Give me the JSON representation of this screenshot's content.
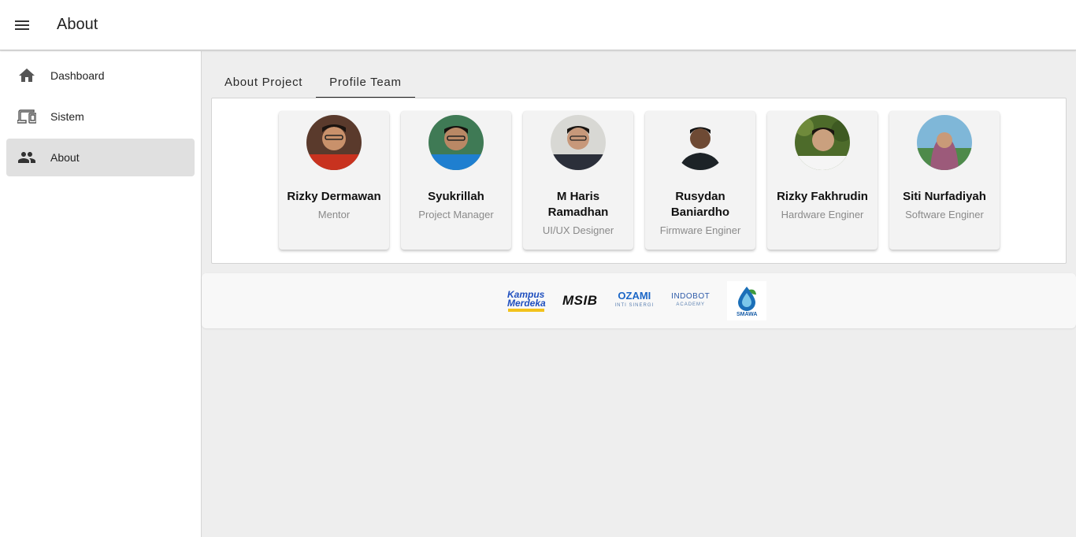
{
  "appbar": {
    "title": "About"
  },
  "sidebar": {
    "items": [
      {
        "label": "Dashboard",
        "icon": "home-icon"
      },
      {
        "label": "Sistem",
        "icon": "devices-icon"
      },
      {
        "label": "About",
        "icon": "people-icon",
        "active": true
      }
    ]
  },
  "tabs": [
    {
      "label": "About Project",
      "active": false
    },
    {
      "label": "Profile Team",
      "active": true
    }
  ],
  "team": [
    {
      "name": "Rizky Dermawan",
      "role": "Mentor"
    },
    {
      "name": "Syukrillah",
      "role": "Project Manager"
    },
    {
      "name": "M Haris Ramadhan",
      "role": "UI/UX Designer"
    },
    {
      "name": "Rusydan Baniardho",
      "role": "Firmware Enginer"
    },
    {
      "name": "Rizky Fakhrudin",
      "role": "Hardware Enginer"
    },
    {
      "name": "Siti Nurfadiyah",
      "role": "Software Enginer"
    }
  ],
  "footer": {
    "logos": [
      {
        "name": "kampus-merdeka-logo",
        "text": "Kampus Merdeka"
      },
      {
        "name": "msib-logo",
        "text": "MSIB"
      },
      {
        "name": "ozami-logo",
        "text": "OZAMI",
        "sub": "INTI SINERGI"
      },
      {
        "name": "indobot-logo",
        "text": "INDOBOT",
        "sub": "ACADEMY"
      },
      {
        "name": "smawa-logo",
        "text": "SMAWA"
      }
    ]
  },
  "colors": {
    "background": "#eeeeee",
    "appbar": "#ffffff",
    "active_nav": "#e0e0e0",
    "card": "#f3f3f3",
    "role_text": "#8a8a8a"
  }
}
